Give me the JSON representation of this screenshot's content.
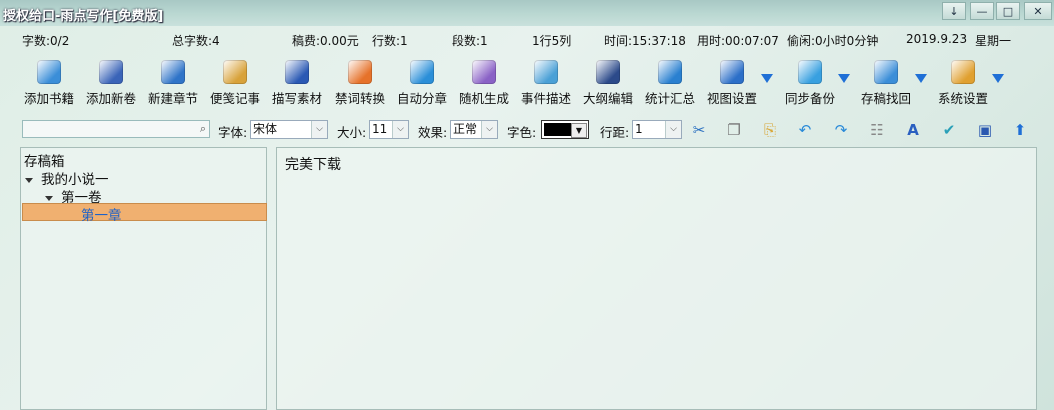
{
  "window": {
    "title": "授权给口-雨点写作[免费版]",
    "controls": [
      "↓",
      "—",
      "□",
      "✕"
    ]
  },
  "status": {
    "chars": "字数:0/2",
    "total_chars": "总字数:4",
    "fee": "稿费:0.00元",
    "lines": "行数:1",
    "paragraphs": "段数:1",
    "cursor": "1行5列",
    "time": "时间:15:37:18",
    "elapsed": "用时:00:07:07",
    "idle": "偷闲:0小时0分钟",
    "date": "2019.9.23",
    "weekday": "星期一"
  },
  "toolbar": [
    {
      "label": "添加书籍",
      "icon": "add-book-icon",
      "color": "#3b8ed8"
    },
    {
      "label": "添加新卷",
      "icon": "add-volume-icon",
      "color": "#3a64b8"
    },
    {
      "label": "新建章节",
      "icon": "new-chapter-icon",
      "color": "#2f74c8"
    },
    {
      "label": "便笺记事",
      "icon": "note-icon",
      "color": "#d8a23a"
    },
    {
      "label": "描写素材",
      "icon": "material-book-icon",
      "color": "#2a59b4"
    },
    {
      "label": "禁词转换",
      "icon": "undo-icon",
      "color": "#e6722a"
    },
    {
      "label": "自动分章",
      "icon": "split-icon",
      "color": "#2b8fd8"
    },
    {
      "label": "随机生成",
      "icon": "users-icon",
      "color": "#8a62c6"
    },
    {
      "label": "事件描述",
      "icon": "folder-icon",
      "color": "#4aa0d6"
    },
    {
      "label": "大纲编辑",
      "icon": "outline-book-icon",
      "color": "#2c4a8a"
    },
    {
      "label": "统计汇总",
      "icon": "text-stats-icon",
      "color": "#2a80d0"
    },
    {
      "label": "视图设置",
      "icon": "window-icon",
      "color": "#2c6fc8"
    },
    {
      "label": "同步备份",
      "icon": "cloud-icon",
      "color": "#38a0e0"
    },
    {
      "label": "存稿找回",
      "icon": "clock-folder-icon",
      "color": "#3b8ed8"
    },
    {
      "label": "系统设置",
      "icon": "gear-icon",
      "color": "#e0a030"
    }
  ],
  "format": {
    "search_placeholder": "",
    "font_label": "字体:",
    "font_value": "宋体",
    "size_label": "大小:",
    "size_value": "11",
    "effect_label": "效果:",
    "effect_value": "正常",
    "color_label": "字色:",
    "spacing_label": "行距:",
    "spacing_value": "1",
    "text_color": "#000000"
  },
  "tree": {
    "root": "存稿箱",
    "book": "我的小说一",
    "volume": "第一卷",
    "chapter": "第一章"
  },
  "editor": {
    "text": "完美下载"
  }
}
